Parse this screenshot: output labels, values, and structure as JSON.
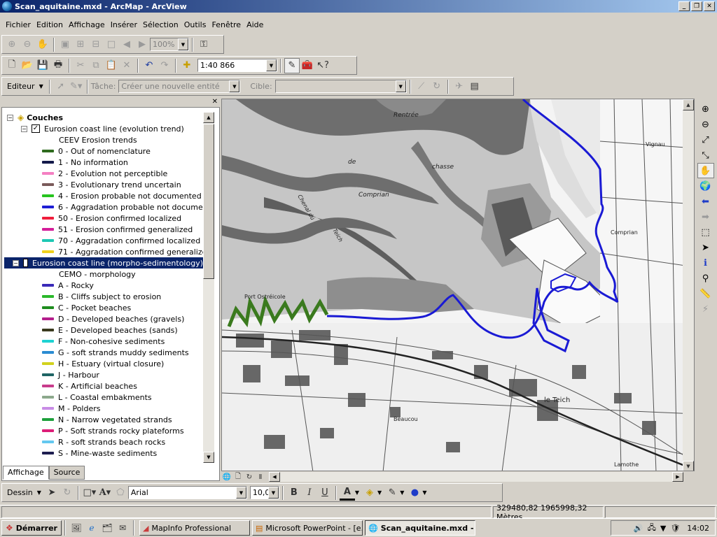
{
  "window": {
    "title": "Scan_aquitaine.mxd - ArcMap - ArcView"
  },
  "menu": [
    "Fichier",
    "Edition",
    "Affichage",
    "Insérer",
    "Sélection",
    "Outils",
    "Fenêtre",
    "Aide"
  ],
  "toolbar_std": {
    "zoom_pct": "100%",
    "scale": "1:40 866"
  },
  "editor": {
    "label": "Editeur",
    "tache_label": "Tâche:",
    "tache_value": "Créer une nouvelle entité",
    "cible_label": "Cible:"
  },
  "toc": {
    "root": "Couches",
    "layer1": {
      "name": "Eurosion coast line (evolution trend)",
      "field": "CEEV Erosion trends",
      "items": [
        {
          "label": "0 - Out of nomenclature",
          "color": "#2f6b1e"
        },
        {
          "label": "1 - No information",
          "color": "#141a4a"
        },
        {
          "label": "2 - Evolution not perceptible",
          "color": "#f47fc2"
        },
        {
          "label": "3 - Evolutionary trend uncertain",
          "color": "#7a5a5a"
        },
        {
          "label": "4 - Erosion probable not documented",
          "color": "#26c41e"
        },
        {
          "label": "6 - Aggradation probable not documented",
          "color": "#1e1ed4"
        },
        {
          "label": "50 - Erosion confirmed localized",
          "color": "#f01e3c"
        },
        {
          "label": "51 - Erosion confirmed generalized",
          "color": "#d41e9a"
        },
        {
          "label": "70 - Aggradation confirmed localized",
          "color": "#1ec8b4"
        },
        {
          "label": "71 - Aggradation confirmed generalized",
          "color": "#f0d21e"
        }
      ]
    },
    "layer2": {
      "name": "Eurosion coast line (morpho-sedimentology)",
      "field": "CEMO - morphology",
      "items": [
        {
          "label": "A - Rocky",
          "color": "#3a2ab8"
        },
        {
          "label": "B - Cliffs subject to erosion",
          "color": "#2ab82a"
        },
        {
          "label": "C - Pocket beaches",
          "color": "#1e8c1e"
        },
        {
          "label": "D - Developed beaches (gravels)",
          "color": "#b41e8c"
        },
        {
          "label": "E - Developed beaches (sands)",
          "color": "#3a3a1e"
        },
        {
          "label": "F - Non-cohesive sediments",
          "color": "#1ed2d2"
        },
        {
          "label": "G - soft strands muddy sediments",
          "color": "#2a8cd2"
        },
        {
          "label": "H - Estuary (virtual closure)",
          "color": "#d2d21e"
        },
        {
          "label": "J - Harbour",
          "color": "#1e6464"
        },
        {
          "label": "K - Artificial beaches",
          "color": "#c83c8c"
        },
        {
          "label": "L - Coastal embakments",
          "color": "#8ca88c"
        },
        {
          "label": "M - Polders",
          "color": "#c88ce6"
        },
        {
          "label": "N - Narrow vegetated strands",
          "color": "#1ea03c"
        },
        {
          "label": "P - Soft strands rocky plateforms",
          "color": "#dc1e78"
        },
        {
          "label": "R - soft strands beach rocks",
          "color": "#64c8f0"
        },
        {
          "label": "S - Mine-waste sediments",
          "color": "#1e1e50"
        }
      ]
    },
    "tabs": [
      "Affichage",
      "Source"
    ]
  },
  "map_labels": [
    "Rentrée",
    "de",
    "chasse",
    "Comprian",
    "Chenal du",
    "Teich",
    "Port Ostréicole",
    "le Teich",
    "Vignau",
    "Comprian",
    "Beaucou",
    "Lamothe"
  ],
  "drawing": {
    "label": "Dessin",
    "font": "Arial",
    "size": "10,00"
  },
  "status": {
    "coords": "329480,82  1965998,32 Mètres"
  },
  "taskbar": {
    "start": "Démarrer",
    "tasks": [
      "MapInfo Professional",
      "Microsoft PowerPoint - [e...",
      "Scan_aquitaine.mxd - ..."
    ],
    "clock": "14:02"
  }
}
